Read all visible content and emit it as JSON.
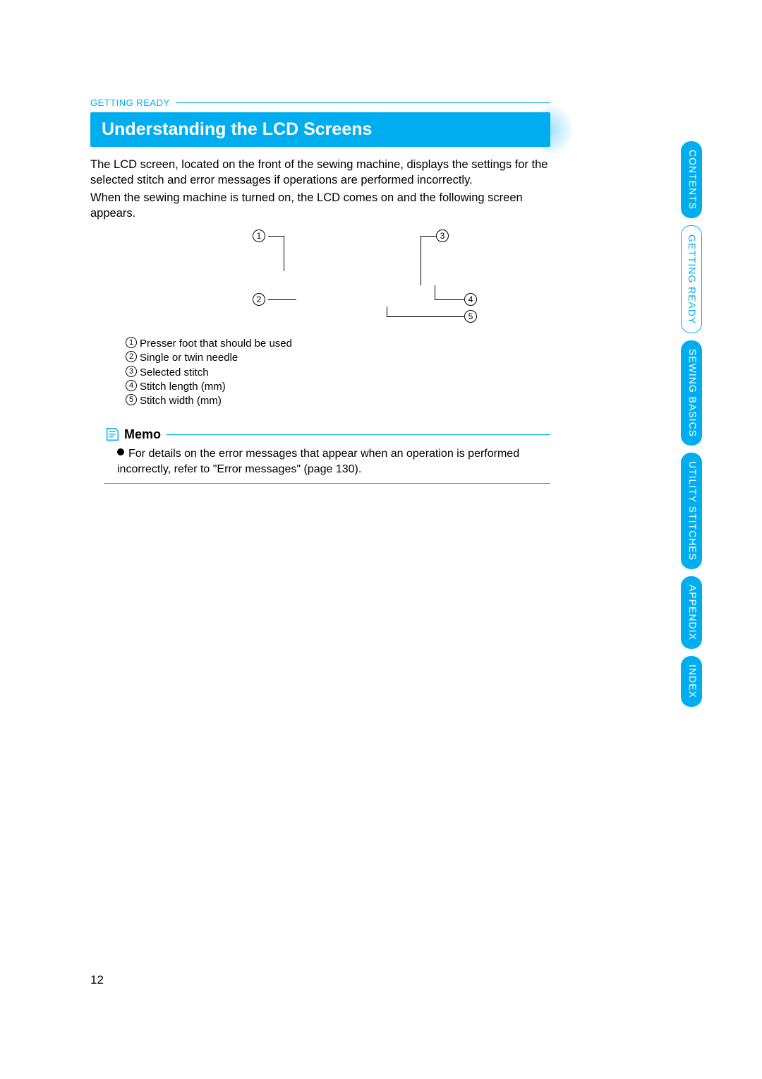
{
  "breadcrumb": "GETTING READY",
  "title": "Understanding the LCD Screens",
  "paragraphs": [
    "The LCD screen, located on the front of the sewing machine, displays the settings for the selected stitch and error messages if operations are performed incorrectly.",
    "When the sewing machine is turned on, the LCD comes on and the following screen appears."
  ],
  "callouts": {
    "c1": "1",
    "c2": "2",
    "c3": "3",
    "c4": "4",
    "c5": "5"
  },
  "legend": [
    {
      "num": "1",
      "text": "Presser foot that should be used"
    },
    {
      "num": "2",
      "text": "Single or twin needle"
    },
    {
      "num": "3",
      "text": "Selected stitch"
    },
    {
      "num": "4",
      "text": "Stitch length (mm)"
    },
    {
      "num": "5",
      "text": "Stitch width (mm)"
    }
  ],
  "memo": {
    "title": "Memo",
    "body": "For details on the error messages that appear when an operation is performed incorrectly, refer to \"Error messages\" (page 130)."
  },
  "tabs": [
    {
      "label": "CONTENTS",
      "style": "solid"
    },
    {
      "label": "GETTING READY",
      "style": "outline"
    },
    {
      "label": "SEWING BASICS",
      "style": "solid"
    },
    {
      "label": "UTILITY STITCHES",
      "style": "solid"
    },
    {
      "label": "APPENDIX",
      "style": "solid"
    },
    {
      "label": "INDEX",
      "style": "solid"
    }
  ],
  "page_number": "12"
}
